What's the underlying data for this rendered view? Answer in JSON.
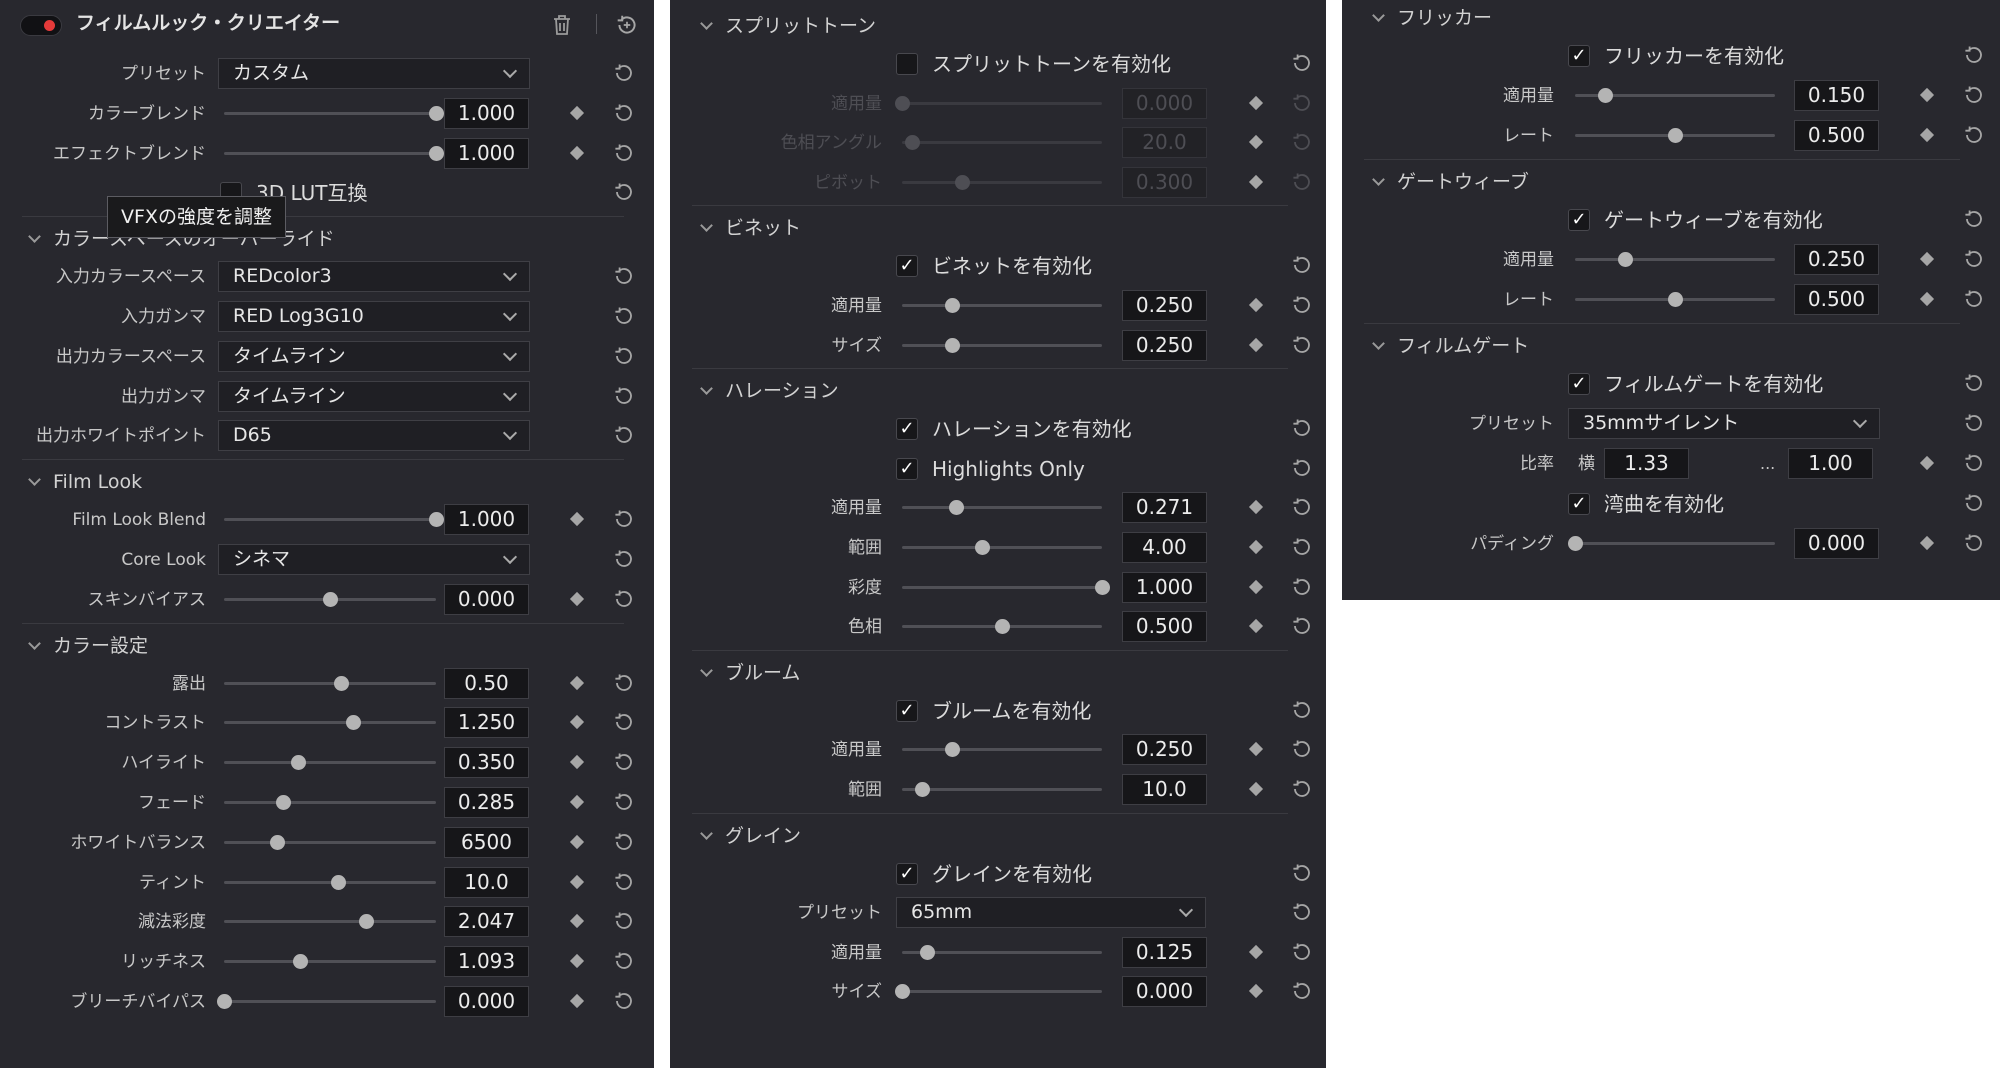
{
  "panel1": {
    "title": "フィルムルック・クリエイター",
    "tooltip": "VFXの強度を調整",
    "top_rows": [
      {
        "type": "select",
        "label": "プリセット",
        "value": "カスタム"
      },
      {
        "type": "slider",
        "label": "カラーブレンド",
        "value": "1.000",
        "fraction": 1.0
      },
      {
        "type": "slider",
        "label": "エフェクトブレンド",
        "value": "1.000",
        "fraction": 1.0
      },
      {
        "type": "check",
        "label": "3D LUT互換",
        "checked": false
      }
    ],
    "sections": [
      {
        "title": "カラースペースのオーバーライド",
        "rows": [
          {
            "type": "select",
            "label": "入力カラースペース",
            "value": "REDcolor3"
          },
          {
            "type": "select",
            "label": "入力ガンマ",
            "value": "RED Log3G10"
          },
          {
            "type": "select",
            "label": "出力カラースペース",
            "value": "タイムライン"
          },
          {
            "type": "select",
            "label": "出力ガンマ",
            "value": "タイムライン"
          },
          {
            "type": "select",
            "label": "出力ホワイトポイント",
            "value": "D65"
          }
        ]
      },
      {
        "title": "Film Look",
        "rows": [
          {
            "type": "slider",
            "label": "Film Look Blend",
            "value": "1.000",
            "fraction": 1.0
          },
          {
            "type": "select",
            "label": "Core Look",
            "value": "シネマ"
          },
          {
            "type": "slider",
            "label": "スキンバイアス",
            "value": "0.000",
            "fraction": 0.5
          }
        ]
      },
      {
        "title": "カラー設定",
        "rows": [
          {
            "type": "slider",
            "label": "露出",
            "value": "0.50",
            "fraction": 0.55
          },
          {
            "type": "slider",
            "label": "コントラスト",
            "value": "1.250",
            "fraction": 0.61
          },
          {
            "type": "slider",
            "label": "ハイライト",
            "value": "0.350",
            "fraction": 0.35
          },
          {
            "type": "slider",
            "label": "フェード",
            "value": "0.285",
            "fraction": 0.28
          },
          {
            "type": "slider",
            "label": "ホワイトバランス",
            "value": "6500",
            "fraction": 0.25
          },
          {
            "type": "slider",
            "label": "ティント",
            "value": "10.0",
            "fraction": 0.54
          },
          {
            "type": "slider",
            "label": "減法彩度",
            "value": "2.047",
            "fraction": 0.67
          },
          {
            "type": "slider",
            "label": "リッチネス",
            "value": "1.093",
            "fraction": 0.36
          },
          {
            "type": "slider",
            "label": "ブリーチバイパス",
            "value": "0.000",
            "fraction": 0.0
          }
        ]
      }
    ]
  },
  "panel2": {
    "sections": [
      {
        "title": "スプリットトーン",
        "rows": [
          {
            "type": "check",
            "label": "スプリットトーンを有効化",
            "checked": false
          },
          {
            "type": "slider",
            "label": "適用量",
            "value": "0.000",
            "fraction": 0.0,
            "disabled": true
          },
          {
            "type": "slider",
            "label": "色相アングル",
            "value": "20.0",
            "fraction": 0.05,
            "disabled": true
          },
          {
            "type": "slider",
            "label": "ピボット",
            "value": "0.300",
            "fraction": 0.3,
            "disabled": true
          }
        ]
      },
      {
        "title": "ビネット",
        "rows": [
          {
            "type": "check",
            "label": "ビネットを有効化",
            "checked": true
          },
          {
            "type": "slider",
            "label": "適用量",
            "value": "0.250",
            "fraction": 0.25
          },
          {
            "type": "slider",
            "label": "サイズ",
            "value": "0.250",
            "fraction": 0.25
          }
        ]
      },
      {
        "title": "ハレーション",
        "rows": [
          {
            "type": "check",
            "label": "ハレーションを有効化",
            "checked": true
          },
          {
            "type": "check",
            "label": "Highlights Only",
            "checked": true
          },
          {
            "type": "slider",
            "label": "適用量",
            "value": "0.271",
            "fraction": 0.27
          },
          {
            "type": "slider",
            "label": "範囲",
            "value": "4.00",
            "fraction": 0.4
          },
          {
            "type": "slider",
            "label": "彩度",
            "value": "1.000",
            "fraction": 1.0
          },
          {
            "type": "slider",
            "label": "色相",
            "value": "0.500",
            "fraction": 0.5
          }
        ]
      },
      {
        "title": "ブルーム",
        "rows": [
          {
            "type": "check",
            "label": "ブルームを有効化",
            "checked": true
          },
          {
            "type": "slider",
            "label": "適用量",
            "value": "0.250",
            "fraction": 0.25
          },
          {
            "type": "slider",
            "label": "範囲",
            "value": "10.0",
            "fraction": 0.1
          }
        ]
      },
      {
        "title": "グレイン",
        "rows": [
          {
            "type": "check",
            "label": "グレインを有効化",
            "checked": true
          },
          {
            "type": "select",
            "label": "プリセット",
            "value": "65mm"
          },
          {
            "type": "slider",
            "label": "適用量",
            "value": "0.125",
            "fraction": 0.125
          },
          {
            "type": "slider",
            "label": "サイズ",
            "value": "0.000",
            "fraction": 0.0
          }
        ]
      }
    ]
  },
  "panel3": {
    "sections": [
      {
        "title": "フリッカー",
        "rows": [
          {
            "type": "check",
            "label": "フリッカーを有効化",
            "checked": true
          },
          {
            "type": "slider",
            "label": "適用量",
            "value": "0.150",
            "fraction": 0.15
          },
          {
            "type": "slider",
            "label": "レート",
            "value": "0.500",
            "fraction": 0.5
          }
        ]
      },
      {
        "title": "ゲートウィーブ",
        "rows": [
          {
            "type": "check",
            "label": "ゲートウィーブを有効化",
            "checked": true
          },
          {
            "type": "slider",
            "label": "適用量",
            "value": "0.250",
            "fraction": 0.25
          },
          {
            "type": "slider",
            "label": "レート",
            "value": "0.500",
            "fraction": 0.5
          }
        ]
      },
      {
        "title": "フィルムゲート",
        "rows": [
          {
            "type": "check",
            "label": "フィルムゲートを有効化",
            "checked": true
          },
          {
            "type": "select",
            "label": "プリセット",
            "value": "35mmサイレント"
          },
          {
            "type": "ratio",
            "label": "比率",
            "prefix": "横",
            "value1": "1.33",
            "separator": "...",
            "value2": "1.00"
          },
          {
            "type": "check",
            "label": "湾曲を有効化",
            "checked": true
          },
          {
            "type": "slider",
            "label": "パディング",
            "value": "0.000",
            "fraction": 0.0
          }
        ]
      }
    ]
  }
}
